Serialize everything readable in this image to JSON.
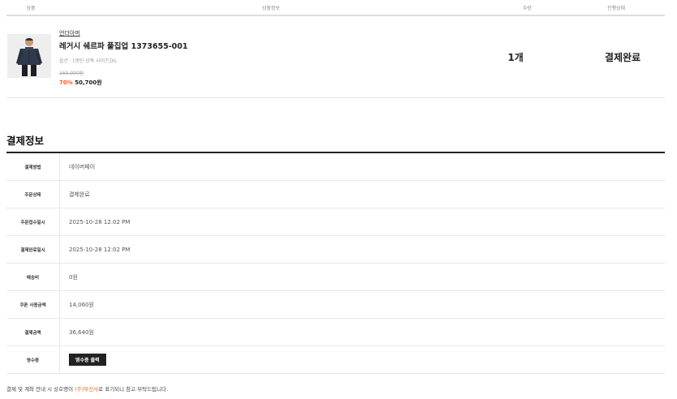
{
  "table_header": {
    "product": "상품",
    "product_info": "상품정보",
    "quantity": "수량",
    "status": "진행상태"
  },
  "order_item": {
    "brand": "언더아머",
    "name": "레거시 쉐르파 풀집업 1373655-001",
    "option": "옵션 : [생인 상복 사이즈]XL",
    "original_price": "169,000원",
    "discount_pct": "70%",
    "sale_price": "50,700원",
    "quantity": "1개",
    "status": "결제완료"
  },
  "payment": {
    "title": "결제정보",
    "rows": [
      {
        "label": "결제방법",
        "value": "네이버페이"
      },
      {
        "label": "주문상태",
        "value": "결제완료"
      },
      {
        "label": "주문접수일시",
        "value": "2025-10-28 12:02 PM"
      },
      {
        "label": "결제완료일시",
        "value": "2025-10-28 12:02 PM"
      },
      {
        "label": "배송비",
        "value": "0원"
      },
      {
        "label": "쿠폰 사용금액",
        "value": "14,060원"
      },
      {
        "label": "결제금액",
        "value": "36,640원"
      },
      {
        "label": "영수증",
        "button": "영수증 출력"
      }
    ]
  },
  "notice": {
    "before": "결제 및 계좌 안내 시 상호명이 ",
    "highlight": "(주)무신사",
    "after": "로 표기되니 참고 부탁드립니다."
  },
  "colors": {
    "accent": "#ff5a1f",
    "dark": "#222222"
  }
}
